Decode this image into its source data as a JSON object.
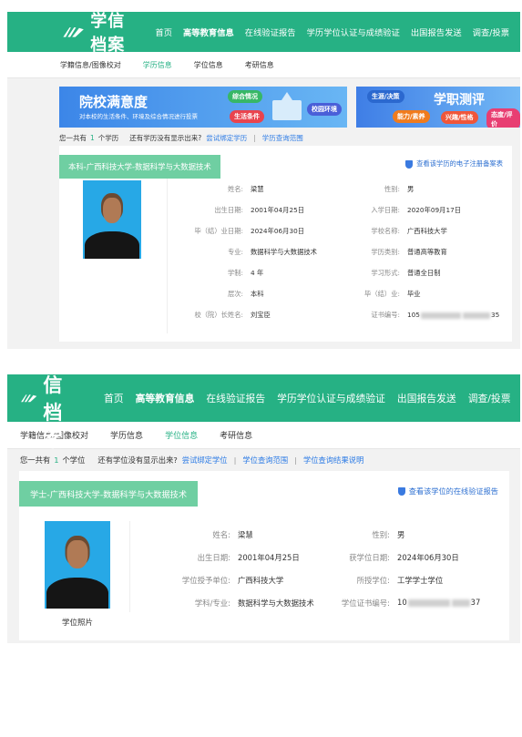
{
  "colors": {
    "brand": "#26b184",
    "link": "#2c7be5",
    "tag": "#6fcfa2"
  },
  "shot1": {
    "logo_text": "学信档案",
    "nav": [
      "首页",
      "高等教育信息",
      "在线验证报告",
      "学历学位认证与成绩验证",
      "出国报告发送",
      "调查/投票"
    ],
    "subnav": [
      "学籍信息/图像校对",
      "学历信息",
      "学位信息",
      "考研信息"
    ],
    "banner1": {
      "title": "院校满意度",
      "subtitle": "对本校的生活条件、环境及综合情况进行投票",
      "tags": [
        "综合情况",
        "生活条件",
        "校园环境"
      ]
    },
    "banner2": {
      "title": "学职测评",
      "tags": [
        "生涯/决策",
        "能力/素养",
        "兴趣/性格",
        "态度/评价"
      ]
    },
    "count": {
      "prefix": "您一共有",
      "num": "1",
      "unit": "个学历",
      "question": "还有学历没有显示出来?",
      "link1": "尝试绑定学历",
      "link2": "学历查询范围"
    },
    "card": {
      "title": "本科-广西科技大学-数据科学与大数据技术",
      "link": "查看该学历的电子注册备案表",
      "fields": [
        {
          "label": "姓名:",
          "value": "梁慧"
        },
        {
          "label": "性别:",
          "value": "男"
        },
        {
          "label": "出生日期:",
          "value": "2001年04月25日"
        },
        {
          "label": "入学日期:",
          "value": "2020年09月17日"
        },
        {
          "label": "毕（结）业日期:",
          "value": "2024年06月30日"
        },
        {
          "label": "学校名称:",
          "value": "广西科技大学"
        },
        {
          "label": "专业:",
          "value": "数据科学与大数据技术"
        },
        {
          "label": "学历类别:",
          "value": "普通高等教育"
        },
        {
          "label": "学制:",
          "value": "4 年"
        },
        {
          "label": "学习形式:",
          "value": "普通全日制"
        },
        {
          "label": "层次:",
          "value": "本科"
        },
        {
          "label": "毕（结）业:",
          "value": "毕业"
        },
        {
          "label": "校（院）长姓名:",
          "value": "刘宝臣"
        },
        {
          "label": "证书编号:",
          "value_start": "105",
          "value_end": "35"
        }
      ]
    }
  },
  "shot2": {
    "logo_text": "学信档案",
    "nav": [
      "首页",
      "高等教育信息",
      "在线验证报告",
      "学历学位认证与成绩验证",
      "出国报告发送",
      "调查/投票"
    ],
    "subnav": [
      "学籍信息/图像校对",
      "学历信息",
      "学位信息",
      "考研信息"
    ],
    "count": {
      "prefix": "您一共有",
      "num": "1",
      "unit": "个学位",
      "question": "还有学位没有显示出来?",
      "link1": "尝试绑定学位",
      "link2": "学位查询范围",
      "link3": "学位查询结果说明"
    },
    "card": {
      "title": "学士-广西科技大学-数据科学与大数据技术",
      "link": "查看该学位的在线验证报告",
      "photo_caption": "学位照片",
      "fields": [
        {
          "label": "姓名:",
          "value": "梁慧"
        },
        {
          "label": "性别:",
          "value": "男"
        },
        {
          "label": "出生日期:",
          "value": "2001年04月25日"
        },
        {
          "label": "获学位日期:",
          "value": "2024年06月30日"
        },
        {
          "label": "学位授予单位:",
          "value": "广西科技大学"
        },
        {
          "label": "所授学位:",
          "value": "工学学士学位"
        },
        {
          "label": "学科/专业:",
          "value": "数据科学与大数据技术"
        },
        {
          "label": "学位证书编号:",
          "value_start": "10",
          "value_end": "37"
        }
      ]
    }
  }
}
